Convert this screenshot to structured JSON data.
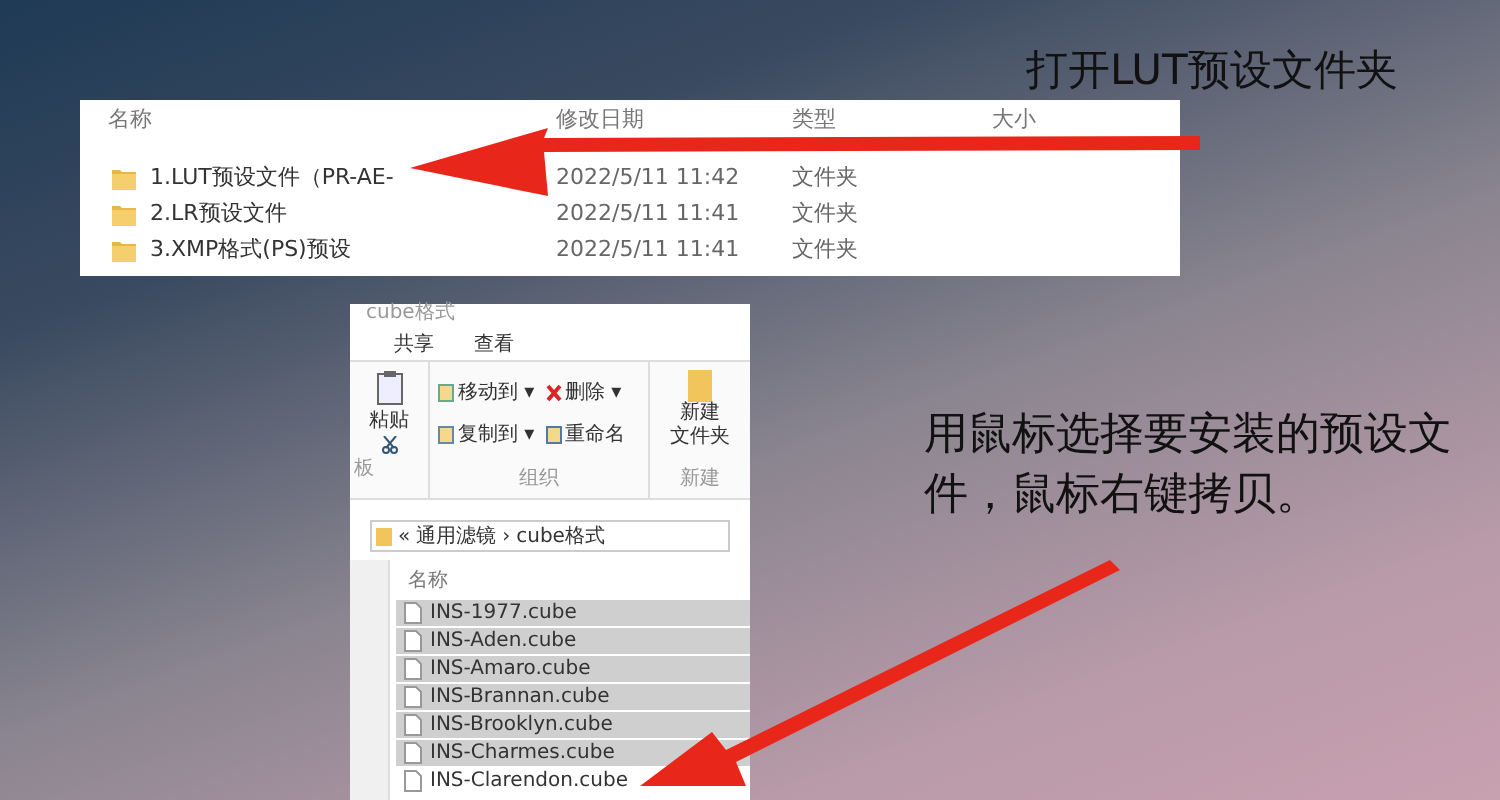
{
  "folder_window": {
    "columns": [
      "名称",
      "修改日期",
      "类型",
      "大小"
    ],
    "rows": [
      {
        "name": "1.LUT预设文件（PR-AE-",
        "date": "2022/5/11 11:42",
        "type": "文件夹",
        "selected": false
      },
      {
        "name": "2.LR预设文件",
        "date": "2022/5/11 11:41",
        "type": "文件夹",
        "selected": false
      },
      {
        "name": "3.XMP格式(PS)预设",
        "date": "2022/5/11 11:41",
        "type": "文件夹",
        "selected": false
      }
    ]
  },
  "annotations": [
    {
      "text": "打开LUT预设文件夹"
    },
    {
      "text": "用鼠标选择要安装的预设文件，鼠标右键拷贝。"
    }
  ],
  "cube_window": {
    "title": "cube格式",
    "tabs": [
      {
        "label": "共享",
        "selected": false
      },
      {
        "label": "查看",
        "selected": false
      }
    ],
    "ribbon": {
      "paste": "粘贴",
      "actions": [
        {
          "kind": "move",
          "label": "移动到",
          "caret": "▾"
        },
        {
          "kind": "delete",
          "label": "删除",
          "caret": "▾"
        },
        {
          "kind": "copy",
          "label": "复制到",
          "caret": "▾"
        },
        {
          "kind": "rename",
          "label": "重命名"
        }
      ],
      "organize": "组织",
      "new_folder": [
        "新建",
        "文件夹"
      ],
      "new": "新建",
      "clipboard_partial": "板"
    },
    "breadcrumb": {
      "prefix": "«",
      "separator": "›",
      "items": [
        "通用滤镜",
        "cube格式"
      ]
    },
    "column": "名称",
    "files": [
      {
        "name": "INS-1977.cube",
        "selected": true
      },
      {
        "name": "INS-Aden.cube",
        "selected": true
      },
      {
        "name": "INS-Amaro.cube",
        "selected": true
      },
      {
        "name": "INS-Brannan.cube",
        "selected": true
      },
      {
        "name": "INS-Brooklyn.cube",
        "selected": true
      },
      {
        "name": "INS-Charmes.cube",
        "selected": true
      },
      {
        "name": "INS-Clarendon.cube",
        "selected": false
      }
    ]
  }
}
